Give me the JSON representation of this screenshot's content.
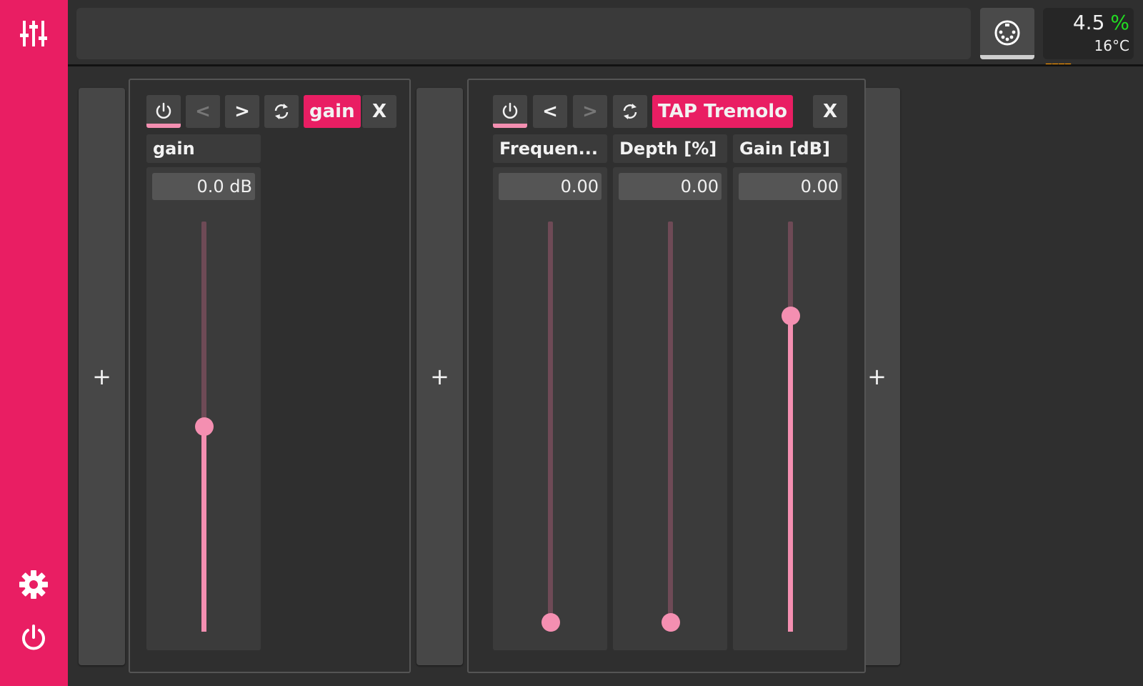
{
  "sidebar": {
    "top_icon": "mixer-sliders-icon",
    "settings_icon": "gear-icon",
    "power_icon": "power-icon"
  },
  "header": {
    "title": "",
    "midi_icon": "midi-port-icon",
    "cpu_usage": "4.5",
    "cpu_unit": "%",
    "temperature": "16°C",
    "meter": "____"
  },
  "add_label": "+",
  "plugins": [
    {
      "name": "gain",
      "prev_label": "<",
      "next_label": ">",
      "close_label": "X",
      "prev_enabled": false,
      "next_enabled": true,
      "controls": [
        {
          "label": "gain",
          "value": "0.0 dB",
          "level": 0.5
        }
      ]
    },
    {
      "name": "TAP Tremolo",
      "prev_label": "<",
      "next_label": ">",
      "close_label": "X",
      "prev_enabled": true,
      "next_enabled": false,
      "controls": [
        {
          "label": "Frequen...",
          "value": "0.00",
          "level": 0.0
        },
        {
          "label": "Depth [%]",
          "value": "0.00",
          "level": 0.0
        },
        {
          "label": "Gain [dB]",
          "value": "0.00",
          "level": 0.77
        }
      ]
    }
  ],
  "colors": {
    "accent": "#e91e63",
    "slider": "#f48fb1",
    "cpu_unit": "#22dd22",
    "meter": "#ff9800"
  }
}
